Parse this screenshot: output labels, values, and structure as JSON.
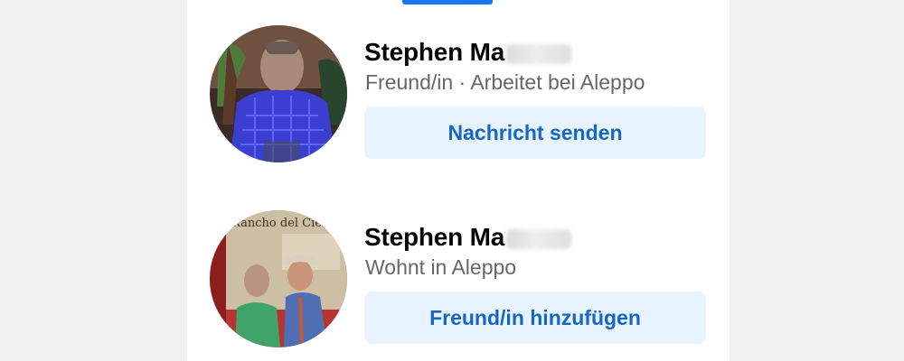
{
  "people": [
    {
      "name": "Stephen Ma",
      "subtitle": "Freund/in · Arbeitet bei Aleppo",
      "action_label": "Nachricht senden"
    },
    {
      "name": "Stephen Ma",
      "subtitle": "Wohnt in Aleppo",
      "action_label": "Freund/in hinzufügen",
      "photo_sign_text": "Rancho del Cielo"
    }
  ],
  "colors": {
    "accent": "#1877f2",
    "button_bg": "#e7f3ff",
    "button_text": "#1666c4",
    "name_text": "#050505",
    "subtitle_text": "#65676b"
  },
  "icons": [
    "profile-photo-1",
    "profile-photo-2"
  ]
}
